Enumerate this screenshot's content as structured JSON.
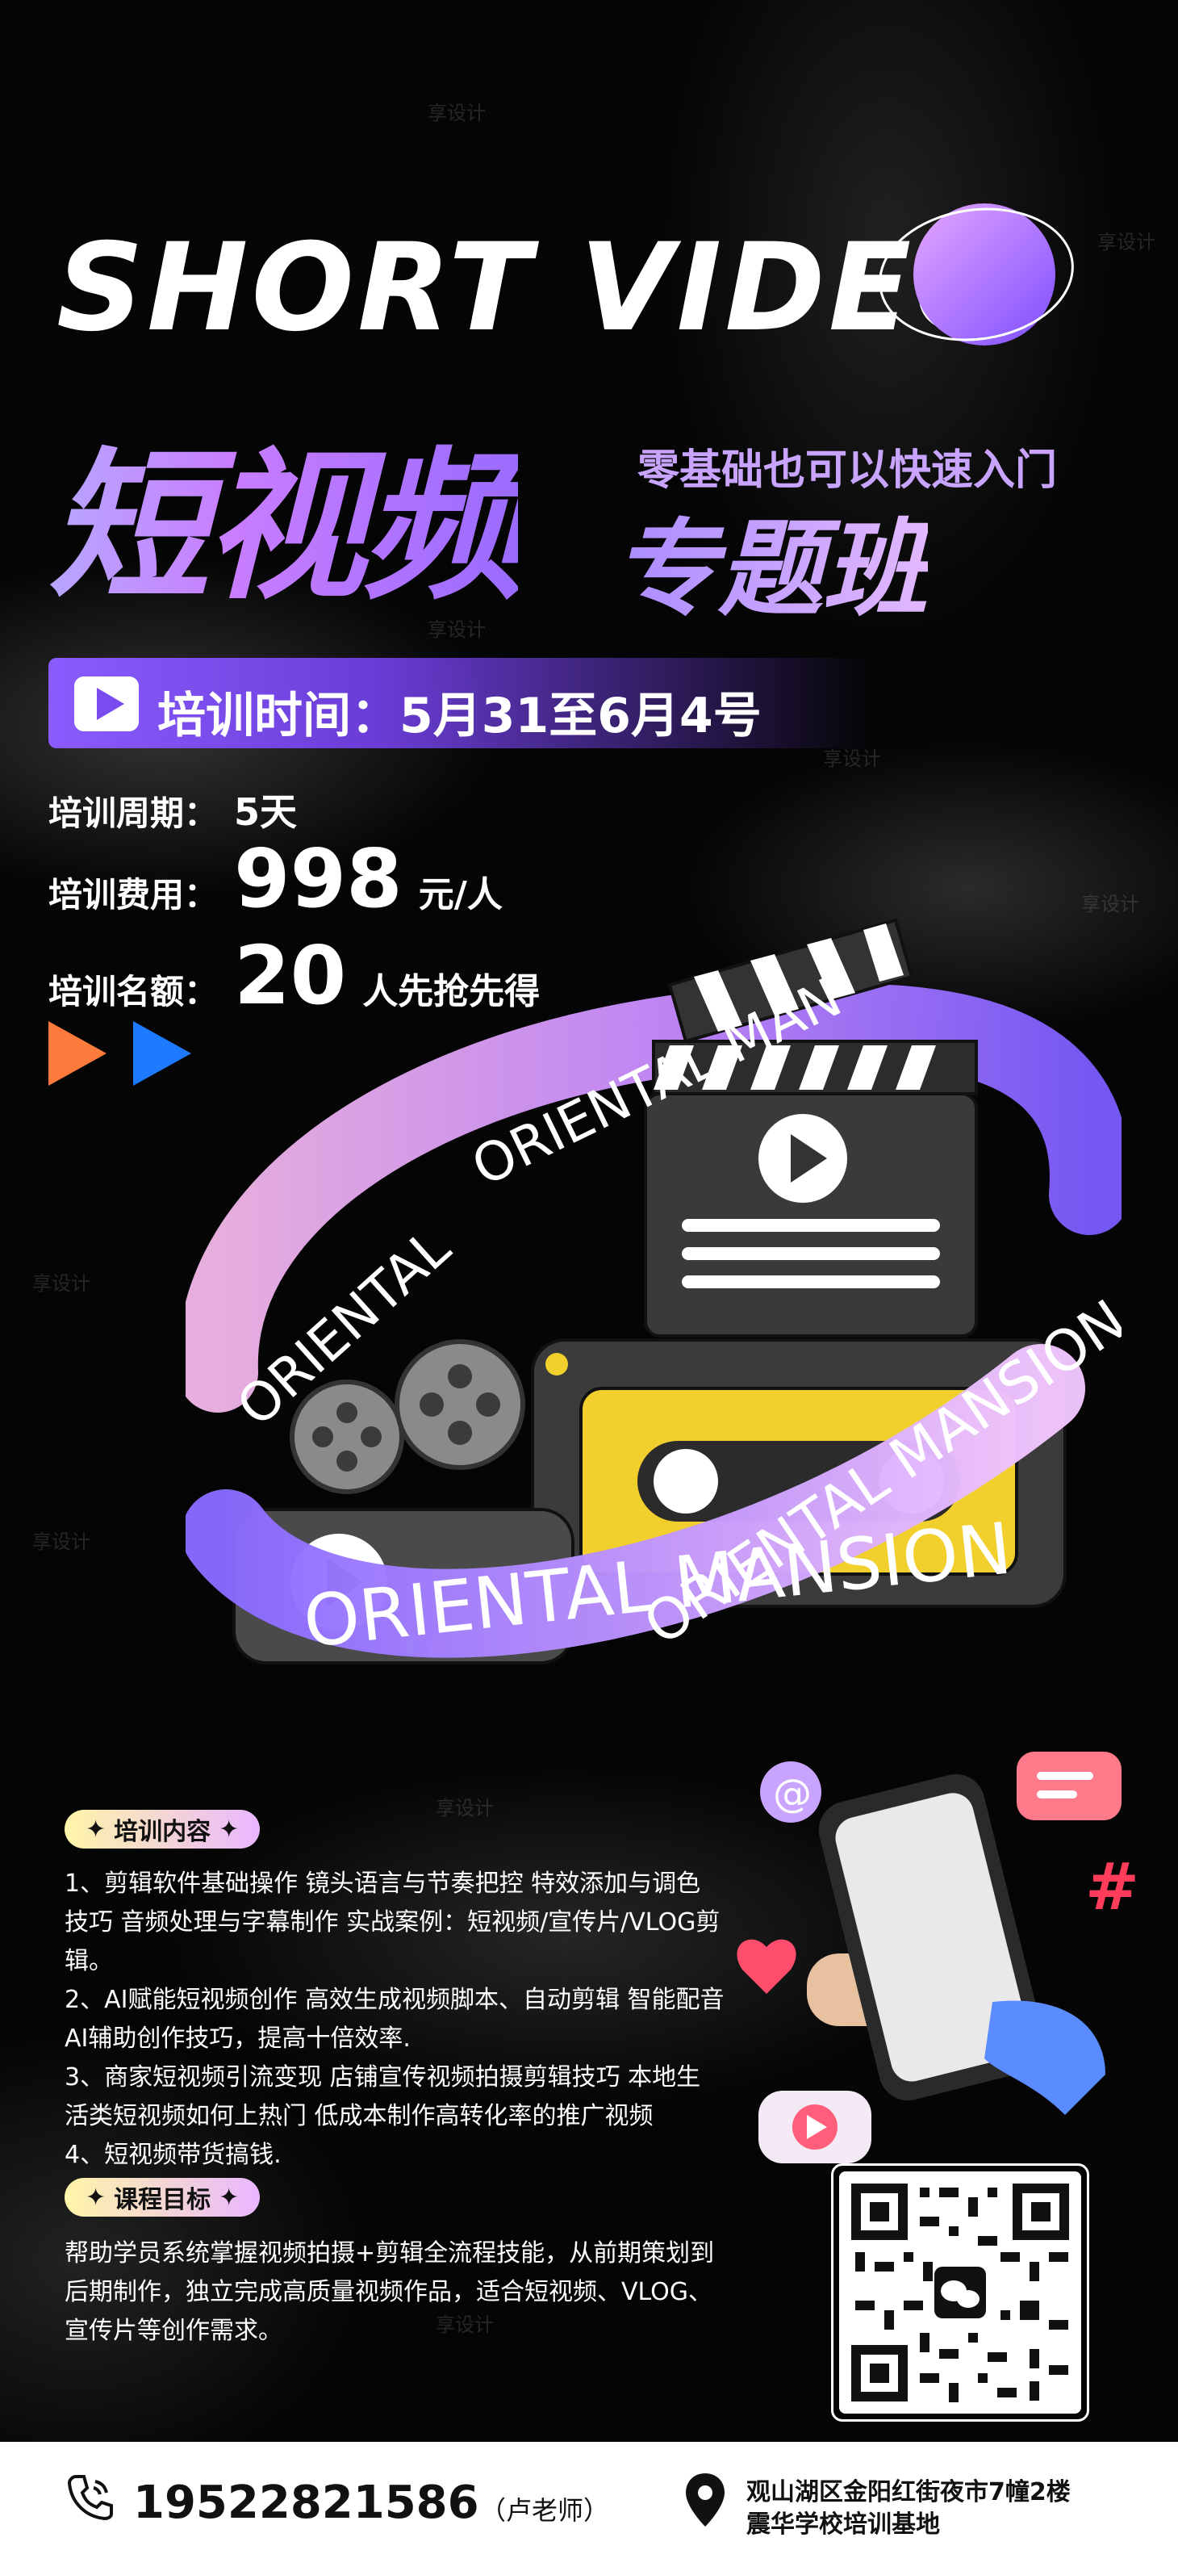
{
  "header": {
    "headline": "SHORT VIDEO",
    "title_main": "短视频",
    "title_sub_small": "零基础也可以快速入门",
    "title_sub_big": "专题班"
  },
  "schedule": {
    "label": "培训时间：5月31至6月4号"
  },
  "info": {
    "period_label": "培训周期：",
    "period_value": "5天",
    "fee_label": "培训费用：",
    "fee_value": "998",
    "fee_unit": "元/人",
    "quota_label": "培训名额：",
    "quota_value": "20",
    "quota_unit": "人先抢先得"
  },
  "ribbon": {
    "text_top": "ORIENTAL MAN",
    "text_left": "ORIENTAL",
    "text_right": "ORIENTAL MANSION",
    "text_bottom": "ORIENTAL MANSION"
  },
  "content_section": {
    "tag": "培训内容",
    "lines": [
      "1、剪辑软件基础操作  镜头语言与节奏把控 特效添加与调色",
      "技巧 音频处理与字幕制作 实战案例：短视频/宣传片/VLOG剪",
      "辑。",
      "2、AI赋能短视频创作 高效生成视频脚本、自动剪辑 智能配音",
      "AI辅助创作技巧，提高十倍效率.",
      "3、商家短视频引流变现 店铺宣传视频拍摄剪辑技巧 本地生",
      "活类短视频如何上热门 低成本制作高转化率的推广视频",
      "4、短视频带货搞钱."
    ]
  },
  "goal_section": {
    "tag": "课程目标",
    "lines": [
      "帮助学员系统掌握视频拍摄+剪辑全流程技能，从前期策划到",
      "后期制作，独立完成高质量视频作品，适合短视频、VLOG、",
      "宣传片等创作需求。"
    ]
  },
  "footer": {
    "phone": "19522821586",
    "teacher": "（卢老师）",
    "address_line1": "观山湖区金阳红街夜市7幢2楼",
    "address_line2": "震华学校培训基地"
  },
  "watermark": "享设计",
  "colors": {
    "accent_purple": "#8a5cff",
    "orange_arrow": "#ff7a3d",
    "blue_arrow": "#1e7bff",
    "tag_gradient_start": "#fff6a8",
    "tag_gradient_end": "#e9b6ff"
  }
}
